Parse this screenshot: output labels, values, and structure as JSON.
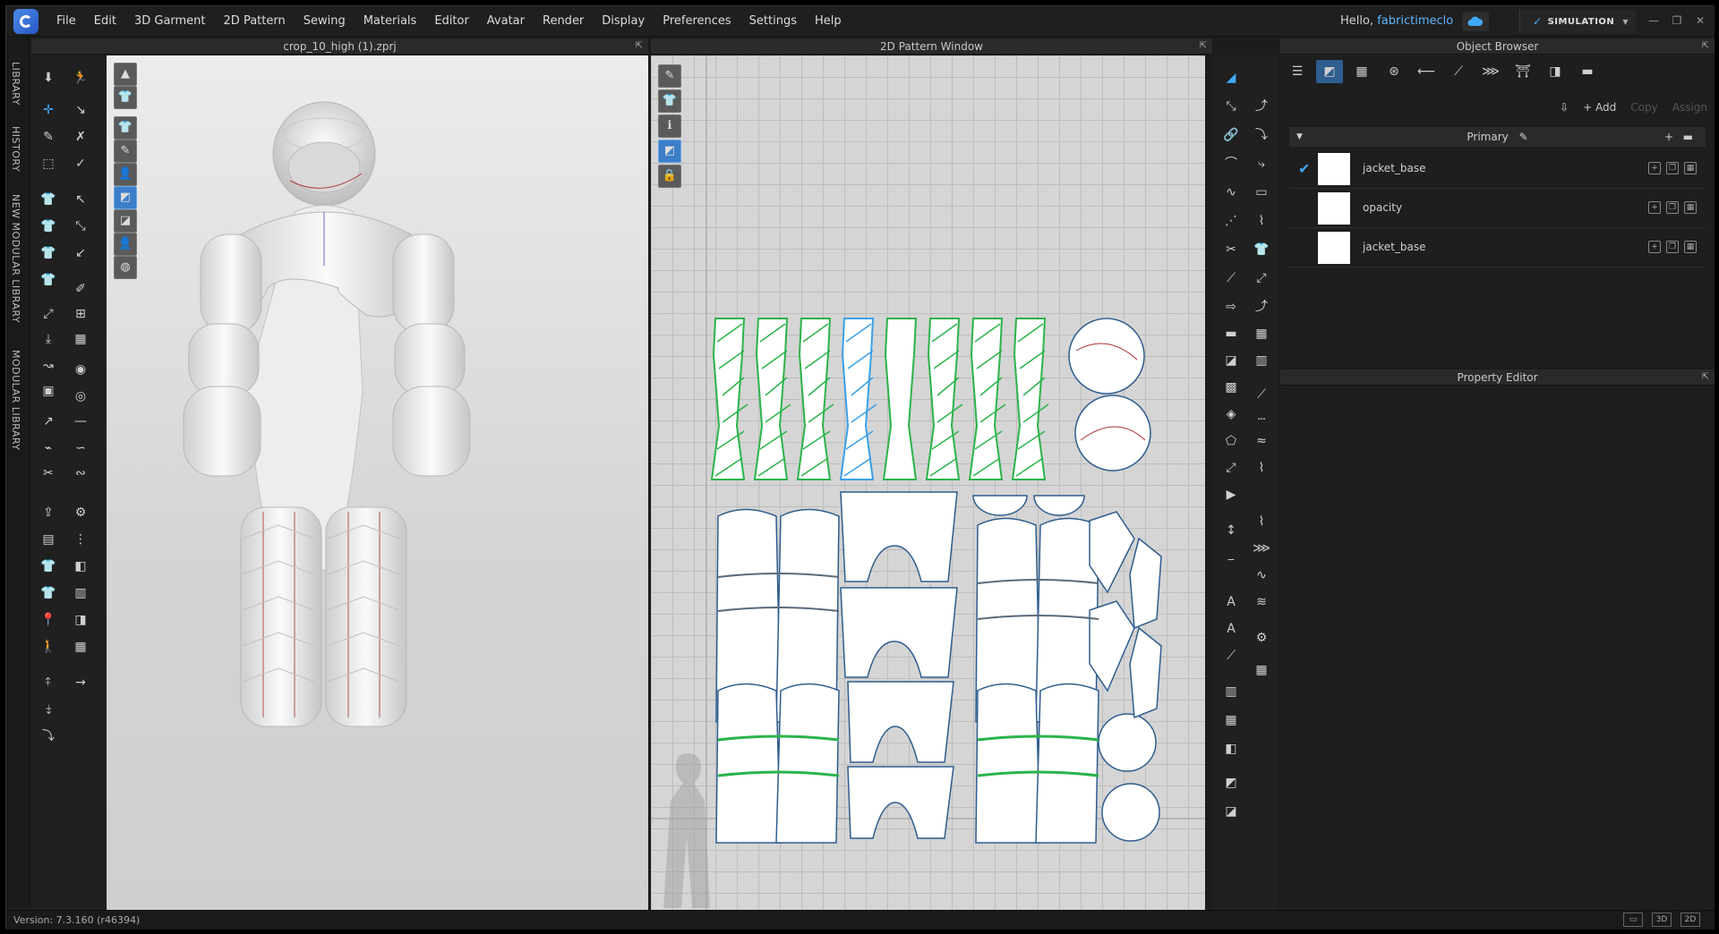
{
  "menubar": {
    "items": [
      "File",
      "Edit",
      "3D Garment",
      "2D Pattern",
      "Sewing",
      "Materials",
      "Editor",
      "Avatar",
      "Render",
      "Display",
      "Preferences",
      "Settings",
      "Help"
    ],
    "greeting": "Hello,",
    "username": "fabrictimeclo",
    "mode": "SIMULATION"
  },
  "left_tabs": [
    "LIBRARY",
    "HISTORY",
    "NEW MODULAR LIBRARY",
    "MODULAR LIBRARY"
  ],
  "panel3d": {
    "title": "crop_10_high (1).zprj"
  },
  "panel2d": {
    "title": "2D Pattern Window"
  },
  "object_browser": {
    "title": "Object Browser",
    "add_label": "+ Add",
    "copy_label": "Copy",
    "assign_label": "Assign",
    "group_label": "Primary",
    "items": [
      {
        "name": "jacket_base",
        "checked": true
      },
      {
        "name": "opacity",
        "checked": false
      },
      {
        "name": "jacket_base",
        "checked": false
      }
    ]
  },
  "property_editor": {
    "title": "Property Editor"
  },
  "statusbar": {
    "version": "Version: 7.3.160 (r46394)",
    "view_buttons": [
      "3D",
      "2D"
    ]
  },
  "colors": {
    "accent": "#3fa9f5",
    "green_seam": "#2bb34a",
    "blue_seam": "#3aa0e8"
  }
}
